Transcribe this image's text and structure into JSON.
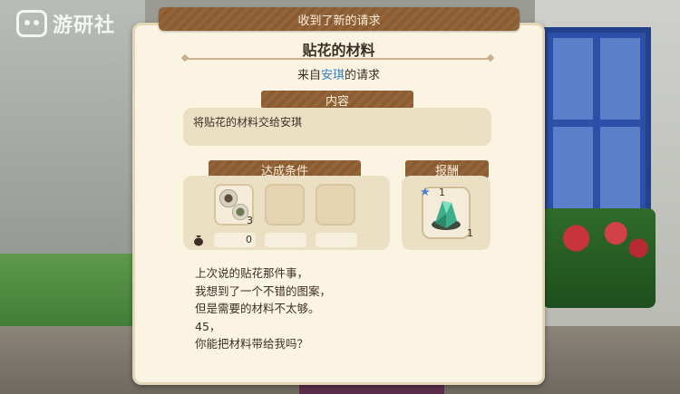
{
  "watermark": {
    "text": "游研社"
  },
  "banner": {
    "text": "收到了新的请求"
  },
  "request": {
    "title": "贴花的材料",
    "from_prefix": "来自",
    "from_npc": "安琪",
    "from_suffix": "的请求"
  },
  "content_section": {
    "heading": "内容",
    "text": "将贴花的材料交给安琪"
  },
  "conditions_section": {
    "heading": "达成条件",
    "required_amount": "3",
    "owned_amount": "0",
    "icons": [
      "material-item-icon",
      "money-bag-icon"
    ]
  },
  "reward_section": {
    "heading": "报酬",
    "badge_number": "1",
    "count": "1",
    "icons": [
      "star-icon",
      "green-crystal-icon"
    ]
  },
  "message": {
    "lines": [
      "上次说的贴花那件事，",
      "我想到了一个不错的图案，",
      "但是需要的材料不太够。",
      "45，",
      "你能把材料带给我吗？"
    ]
  },
  "colors": {
    "panel_bg": "#fbf4e3",
    "banner_brown": "#8b5b32",
    "npc_name_blue": "#2f7fc4",
    "box_bg": "#ece0c4"
  }
}
